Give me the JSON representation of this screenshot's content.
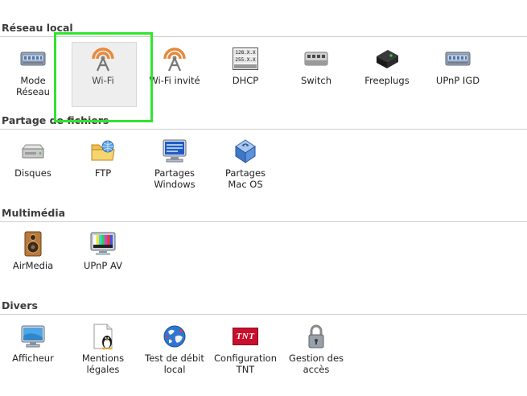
{
  "sections": [
    {
      "title": "Réseau local",
      "items": [
        {
          "label": "Mode\nRéseau",
          "icon": "network-card-icon"
        },
        {
          "label": "Wi-Fi",
          "icon": "wifi-antenna-icon",
          "selected": true
        },
        {
          "label": "Wi-Fi invité",
          "icon": "wifi-antenna-icon"
        },
        {
          "label": "DHCP",
          "icon": "dhcp-icon"
        },
        {
          "label": "Switch",
          "icon": "switch-icon"
        },
        {
          "label": "Freeplugs",
          "icon": "freeplug-icon"
        },
        {
          "label": "UPnP IGD",
          "icon": "network-card-icon"
        }
      ]
    },
    {
      "title": "Partage de fichiers",
      "items": [
        {
          "label": "Disques",
          "icon": "hard-disk-icon"
        },
        {
          "label": "FTP",
          "icon": "ftp-folder-icon"
        },
        {
          "label": "Partages\nWindows",
          "icon": "windows-share-icon"
        },
        {
          "label": "Partages\nMac OS",
          "icon": "mac-share-icon"
        }
      ]
    },
    {
      "title": "Multimédia",
      "items": [
        {
          "label": "AirMedia",
          "icon": "speaker-icon"
        },
        {
          "label": "UPnP AV",
          "icon": "tv-test-pattern-icon"
        }
      ]
    },
    {
      "title": "Divers",
      "items": [
        {
          "label": "Afficheur",
          "icon": "display-icon"
        },
        {
          "label": "Mentions\nlégales",
          "icon": "tux-icon"
        },
        {
          "label": "Test de débit\nlocal",
          "icon": "globe-icon"
        },
        {
          "label": "Configuration\nTNT",
          "icon": "tnt-icon"
        },
        {
          "label": "Gestion des\naccès",
          "icon": "padlock-icon"
        }
      ]
    }
  ],
  "dhcp_lines": [
    "128.X.X",
    "255.X.X"
  ],
  "tnt_text": "TNT",
  "colors": {
    "accent_focus": "#2ee52e",
    "wifi_orange": "#e8893a",
    "selected_bg": "#eeeeee"
  }
}
